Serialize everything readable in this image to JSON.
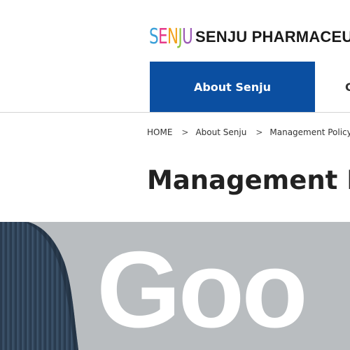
{
  "header": {
    "logo_mark": "SENJU",
    "logo_text": "SENJU PHARMACEUTICAL",
    "logo_colors": [
      "#3aa0d8",
      "#e63a8a",
      "#f2a11c",
      "#8cc63f",
      "#9b59b6"
    ]
  },
  "nav": {
    "items": [
      {
        "label": "About Senju",
        "active": true
      },
      {
        "label": "C",
        "active": false
      }
    ],
    "accent_color": "#0b4fa1"
  },
  "breadcrumb": {
    "items": [
      "HOME",
      "About Senju",
      "Management Policy"
    ],
    "separator": ">"
  },
  "page": {
    "title": "Management Policy"
  },
  "hero": {
    "text": "Goo"
  }
}
